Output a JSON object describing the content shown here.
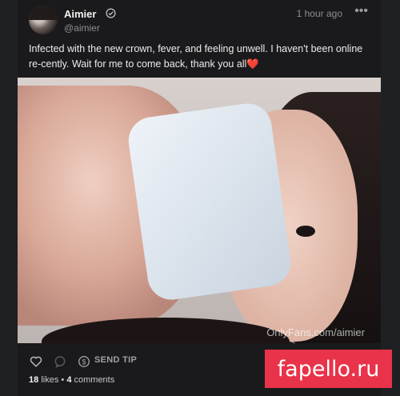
{
  "post": {
    "author_name": "Aimier",
    "author_handle": "@aimier",
    "time": "1 hour ago",
    "text": "Infected with the new crown, fever, and feeling unwell. I haven't been online re-cently. Wait for me to come back, thank you all❤️",
    "media_watermark": "OnlyFans.com/aimier"
  },
  "actions": {
    "send_tip_label": "SEND TIP"
  },
  "stats": {
    "likes_count": "18",
    "likes_label": "likes",
    "separator": "•",
    "comments_count": "4",
    "comments_label": "comments"
  },
  "overlay": {
    "site_badge": "fapello.ru"
  },
  "icons": [
    "verified-icon",
    "more-options-icon",
    "heart-icon",
    "comment-icon",
    "dollar-icon"
  ],
  "colors": {
    "background": "#1a1a1c",
    "badge": "#e8334a",
    "muted_text": "#8d8e92"
  }
}
